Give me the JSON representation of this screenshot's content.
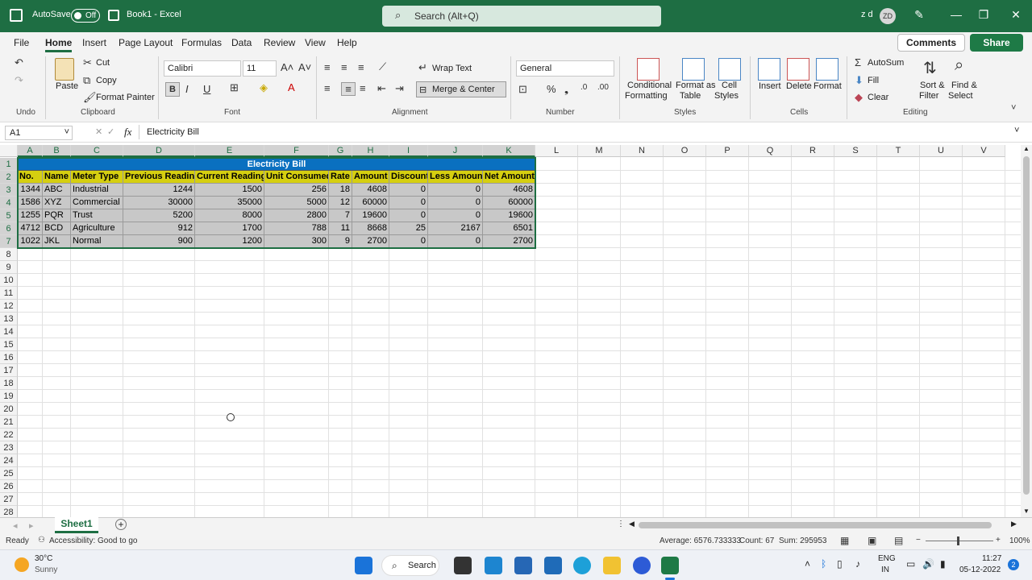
{
  "titlebar": {
    "autosave_label": "AutoSave",
    "autosave_state": "Off",
    "doc_title": "Book1 - Excel",
    "search_placeholder": "Search (Alt+Q)",
    "user_name": "z d",
    "user_initials": "ZD"
  },
  "menu": {
    "items": [
      "File",
      "Home",
      "Insert",
      "Page Layout",
      "Formulas",
      "Data",
      "Review",
      "View",
      "Help"
    ],
    "active": "Home",
    "comments_label": "Comments",
    "share_label": "Share"
  },
  "ribbon": {
    "undo_group": "Undo",
    "clipboard": {
      "paste": "Paste",
      "cut": "Cut",
      "copy": "Copy",
      "format_painter": "Format Painter",
      "group": "Clipboard"
    },
    "font": {
      "name": "Calibri",
      "size": "11",
      "group": "Font"
    },
    "alignment": {
      "wrap_text": "Wrap Text",
      "merge_center": "Merge & Center",
      "group": "Alignment"
    },
    "number": {
      "format": "General",
      "group": "Number"
    },
    "styles": {
      "conditional": "Conditional",
      "conditional2": "Formatting",
      "format_as": "Format as",
      "format_as2": "Table",
      "cell": "Cell",
      "cell2": "Styles",
      "group": "Styles"
    },
    "cells": {
      "insert": "Insert",
      "delete": "Delete",
      "format": "Format",
      "group": "Cells"
    },
    "editing": {
      "autosum": "AutoSum",
      "fill": "Fill",
      "clear": "Clear",
      "sort": "Sort &",
      "sort2": "Filter",
      "find": "Find &",
      "find2": "Select",
      "group": "Editing"
    }
  },
  "formula_bar": {
    "name_box": "A1",
    "fx": "fx",
    "content": "Electricity Bill"
  },
  "sheet": {
    "columns": [
      "A",
      "B",
      "C",
      "D",
      "E",
      "F",
      "G",
      "H",
      "I",
      "J",
      "K",
      "L",
      "M",
      "N",
      "O",
      "P",
      "Q",
      "R",
      "S",
      "T",
      "U",
      "V"
    ],
    "rows": [
      "1",
      "2",
      "3",
      "4",
      "5",
      "6",
      "7",
      "8",
      "9",
      "10",
      "11",
      "12",
      "13",
      "14",
      "15",
      "16",
      "17",
      "18",
      "19",
      "20",
      "21",
      "22",
      "23",
      "24",
      "25",
      "26",
      "27",
      "28"
    ],
    "title": "Electricity Bill",
    "headers": [
      "No.",
      "Name",
      "Meter Type",
      "Previous Reading",
      "Current Reading",
      "Unit Consumed",
      "Rate",
      "Amount",
      "Discount",
      "Less Amount",
      "Net Amount"
    ],
    "data": [
      [
        "1344",
        "ABC",
        "Industrial",
        "1244",
        "1500",
        "256",
        "18",
        "4608",
        "0",
        "0",
        "4608"
      ],
      [
        "1586",
        "XYZ",
        "Commercial",
        "30000",
        "35000",
        "5000",
        "12",
        "60000",
        "0",
        "0",
        "60000"
      ],
      [
        "1255",
        "PQR",
        "Trust",
        "5200",
        "8000",
        "2800",
        "7",
        "19600",
        "0",
        "0",
        "19600"
      ],
      [
        "4712",
        "BCD",
        "Agriculture",
        "912",
        "1700",
        "788",
        "11",
        "8668",
        "25",
        "2167",
        "6501"
      ],
      [
        "1022",
        "JKL",
        "Normal",
        "900",
        "1200",
        "300",
        "9",
        "2700",
        "0",
        "0",
        "2700"
      ]
    ]
  },
  "tabs": {
    "sheet1": "Sheet1"
  },
  "status": {
    "ready": "Ready",
    "accessibility": "Accessibility: Good to go",
    "average": "Average: 6576.733333",
    "count": "Count: 67",
    "sum": "Sum: 295953",
    "zoom": "100%"
  },
  "taskbar": {
    "temp": "30°C",
    "weather": "Sunny",
    "search": "Search",
    "lang1": "ENG",
    "lang2": "IN",
    "time": "11:27",
    "date": "05-12-2022",
    "notif": "2"
  },
  "colors": {
    "title_bar": "#1e6e43",
    "title_fill": "#0a70c0",
    "header_fill": "#d6cf10",
    "data_fill": "#c8c8c8"
  }
}
